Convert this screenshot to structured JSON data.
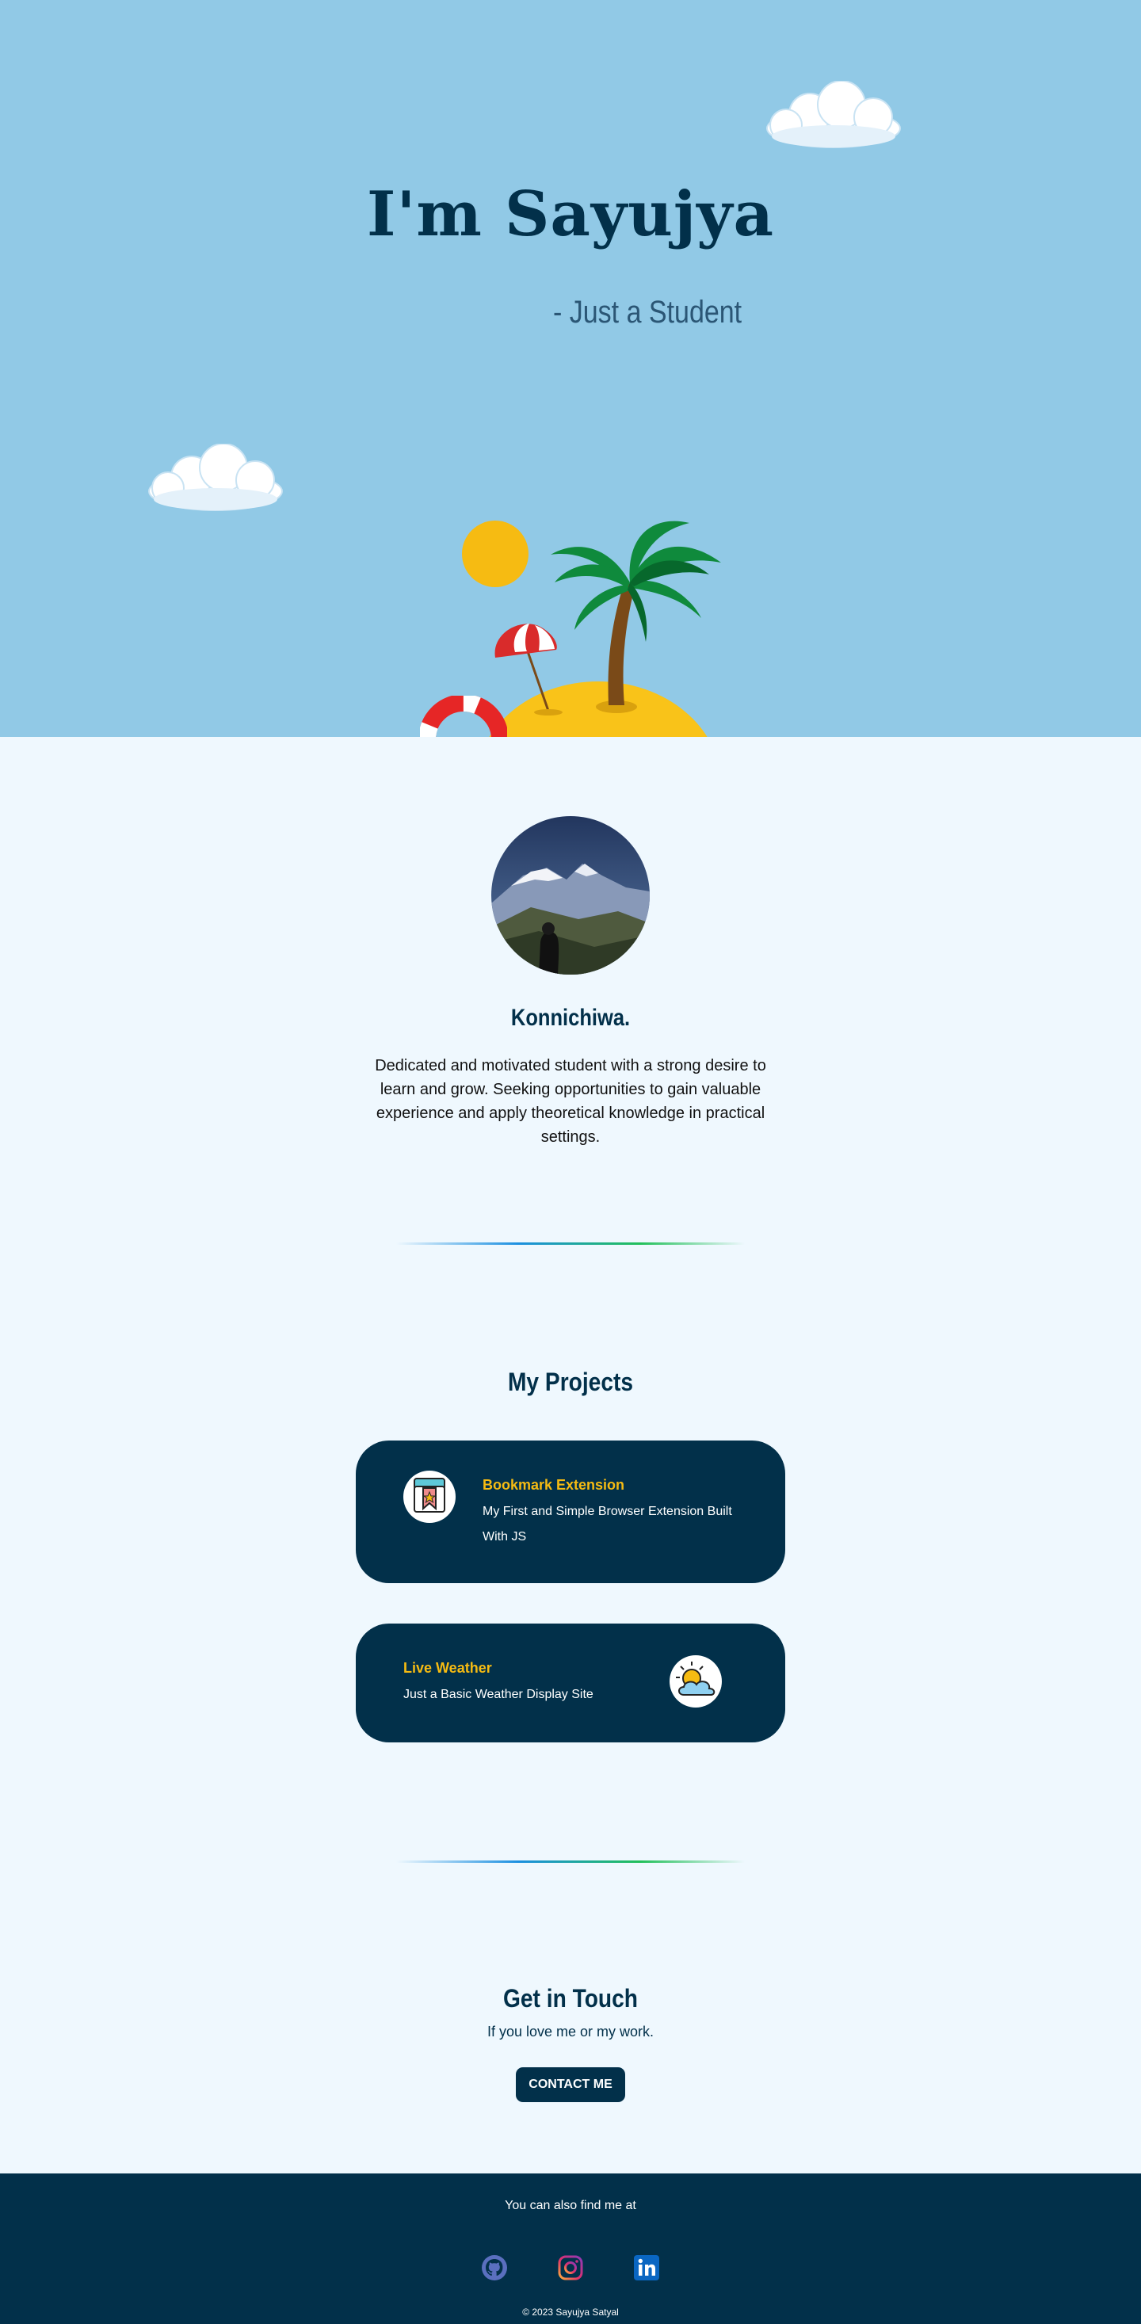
{
  "hero": {
    "title": "I'm Sayujya",
    "subtitle": "- Just a Student"
  },
  "about": {
    "greeting": "Konnichiwa.",
    "bio": "Dedicated and motivated student with a strong desire to learn and grow. Seeking opportunities to gain valuable experience and apply theoretical knowledge in practical settings."
  },
  "projects": {
    "title": "My Projects",
    "items": [
      {
        "title": "Bookmark Extension",
        "description": "My First and Simple Browser Extension Built With JS",
        "icon": "bookmark-icon"
      },
      {
        "title": "Live Weather",
        "description": "Just a Basic Weather Display Site",
        "icon": "weather-icon"
      }
    ]
  },
  "contact": {
    "title": "Get in Touch",
    "subtitle": "If you love me or my work.",
    "button_label": "CONTACT ME"
  },
  "footer": {
    "find_me": "You can also find me at",
    "social": [
      "github-icon",
      "instagram-icon",
      "linkedin-icon"
    ],
    "copyright": "© 2023 Sayujya Satyal"
  },
  "colors": {
    "sky": "#91c9e6",
    "navy": "#02304a",
    "accent": "#f6bb12",
    "background": "#eff8fe"
  }
}
